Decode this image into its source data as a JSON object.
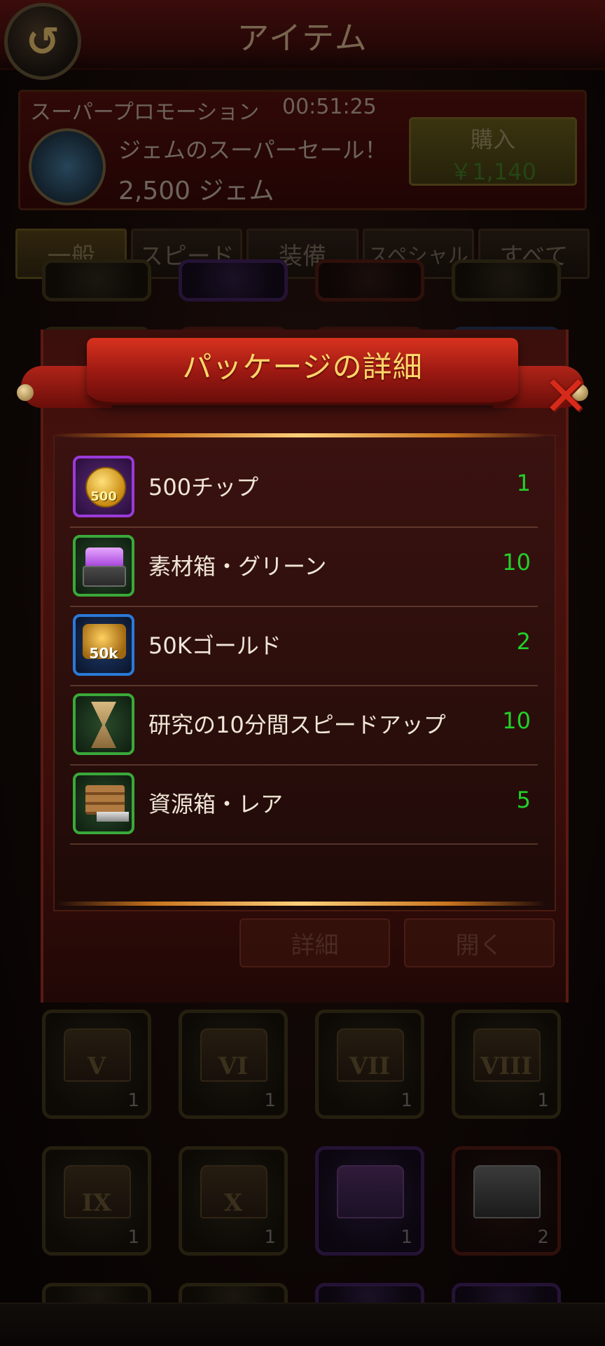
{
  "header": {
    "title": "アイテム",
    "back_glyph": "↺"
  },
  "promo": {
    "title": "スーパープロモーション",
    "timer": "00:51:25",
    "name": "ジェムのスーパーセール！",
    "amount": "2,500 ジェム",
    "buy_label": "購入",
    "price": "￥1,140"
  },
  "tabs": [
    {
      "label": "一般",
      "active": true
    },
    {
      "label": "スピード",
      "active": false
    },
    {
      "label": "装備",
      "active": false
    },
    {
      "label": "スペシャル",
      "active": false
    },
    {
      "label": "すべて",
      "active": false
    }
  ],
  "grid": {
    "row1": [
      {
        "numeral": "V",
        "count": "1"
      },
      {
        "numeral": "VI",
        "count": "1"
      },
      {
        "numeral": "VII",
        "count": "1"
      },
      {
        "numeral": "VIII",
        "count": "1"
      }
    ],
    "row2": [
      {
        "numeral": "IX",
        "count": "1"
      },
      {
        "numeral": "X",
        "count": "1"
      },
      {
        "numeral": "",
        "count": "1"
      },
      {
        "numeral": "",
        "count": "2"
      }
    ]
  },
  "modal": {
    "title": "パッケージの詳細",
    "close_glyph": "✕",
    "detail_label": "詳細",
    "open_label": "開く",
    "items": [
      {
        "name": "500チップ",
        "qty": "1",
        "icon": "chips-icon",
        "icon_text": "500",
        "frame": "purple"
      },
      {
        "name": "素材箱・グリーン",
        "qty": "10",
        "icon": "material-box-icon",
        "icon_text": "",
        "frame": "green"
      },
      {
        "name": "50Kゴールド",
        "qty": "2",
        "icon": "gold-icon",
        "icon_text": "50k",
        "frame": "blue"
      },
      {
        "name": "研究の10分間スピードアップ",
        "qty": "10",
        "icon": "hourglass-icon",
        "icon_text": "",
        "frame": "green"
      },
      {
        "name": "資源箱・レア",
        "qty": "5",
        "icon": "resource-box-icon",
        "icon_text": "",
        "frame": "green"
      }
    ]
  },
  "colors": {
    "quantity": "#22d02a",
    "banner_title": "#ffd66a",
    "close": "#d82a1a"
  }
}
